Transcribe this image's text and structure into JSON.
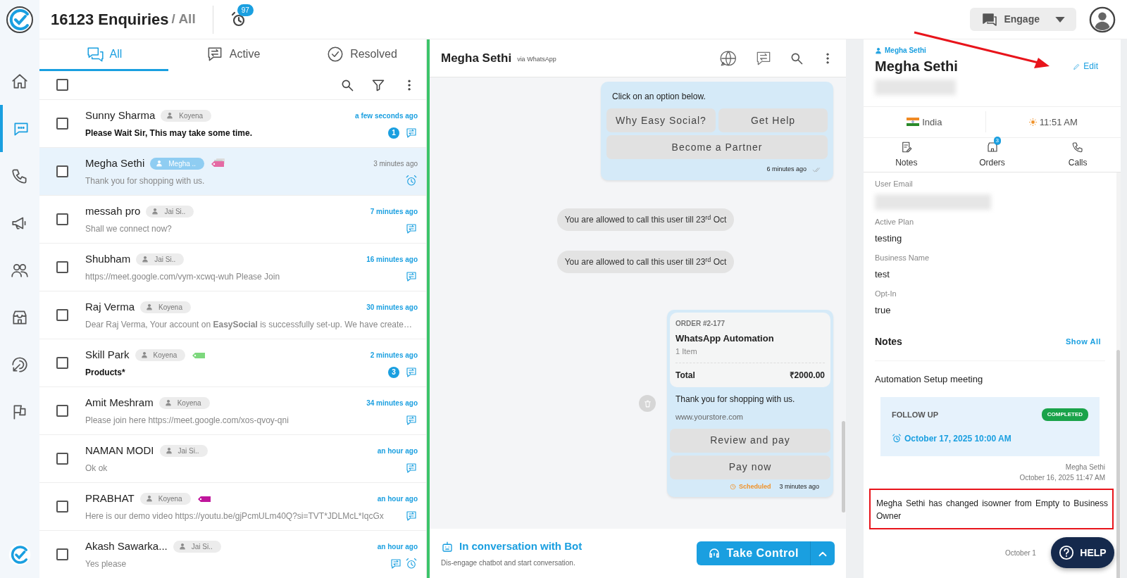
{
  "header": {
    "title": "16123 Enquiries",
    "scope": "/ All",
    "reminder_count": "97",
    "engage": "Engage"
  },
  "rail": [
    {
      "kind": "home",
      "selected": false
    },
    {
      "kind": "chat",
      "selected": true
    },
    {
      "kind": "phone",
      "selected": false
    },
    {
      "kind": "megaphone",
      "selected": false
    },
    {
      "kind": "people",
      "selected": false
    },
    {
      "kind": "store",
      "selected": false
    },
    {
      "kind": "radar",
      "selected": false
    },
    {
      "kind": "flags",
      "selected": false
    }
  ],
  "tabs": [
    {
      "label": "All",
      "kind": "all",
      "selected": true
    },
    {
      "label": "Active",
      "kind": "active",
      "selected": false
    },
    {
      "label": "Resolved",
      "kind": "resolved",
      "selected": false
    }
  ],
  "list": {
    "select_all_checked": false,
    "rows": [
      {
        "name": "Sunny Sharma",
        "agent": "Koyena",
        "agent_mine": false,
        "time": "a few seconds ago",
        "preview": "Please Wait Sir, This may take some time.",
        "unread": true,
        "unread_count": "1",
        "chat_icon": true,
        "alarm_icon": false,
        "selected": false,
        "checked": false
      },
      {
        "name": "Megha Sethi",
        "agent": "Megha ..",
        "agent_mine": true,
        "tag": {
          "kind": "stack",
          "color": "#e46aa4"
        },
        "time": "3 minutes ago",
        "preview": "Thank you for shopping with us.",
        "unread": false,
        "chat_icon": false,
        "alarm_icon": true,
        "selected": true,
        "checked": false
      },
      {
        "name": "messah pro",
        "agent": "Jai Si..",
        "agent_mine": false,
        "time": "7 minutes ago",
        "preview": "Shall we connect now?",
        "unread": false,
        "chat_icon": true,
        "alarm_icon": false,
        "selected": false,
        "checked": false
      },
      {
        "name": "Shubham",
        "agent": "Jai Si..",
        "agent_mine": false,
        "time": "16 minutes ago",
        "preview": "https://meet.google.com/vym-xcwq-wuh Please Join",
        "unread": false,
        "chat_icon": true,
        "alarm_icon": false,
        "selected": false,
        "checked": false
      },
      {
        "name": "Raj Verma",
        "agent": "Koyena",
        "agent_mine": false,
        "time": "30 minutes ago",
        "preview": "Dear Raj Verma, Your account on **EasySocial** is successfully set-up. We have create…",
        "unread": false,
        "chat_icon": false,
        "alarm_icon": false,
        "selected": false,
        "checked": false
      },
      {
        "name": "Skill Park",
        "agent": "Koyena",
        "agent_mine": false,
        "tag": {
          "kind": "single",
          "color": "#7dd87d"
        },
        "time": "2 minutes ago",
        "preview": "Products*",
        "unread": true,
        "unread_count": "3",
        "chat_icon": true,
        "alarm_icon": false,
        "selected": false,
        "checked": false
      },
      {
        "name": "Amit Meshram",
        "agent": "Koyena",
        "agent_mine": false,
        "time": "34 minutes ago",
        "preview": "Please join here https://meet.google.com/xos-qvoy-qni",
        "unread": false,
        "chat_icon": true,
        "alarm_icon": false,
        "selected": false,
        "checked": false
      },
      {
        "name": "NAMAN MODI",
        "agent": "Jai Si..",
        "agent_mine": false,
        "time": "an hour ago",
        "preview": "Ok ok",
        "unread": false,
        "chat_icon": true,
        "alarm_icon": false,
        "selected": false,
        "checked": false
      },
      {
        "name": "PRABHAT",
        "agent": "Koyena",
        "agent_mine": false,
        "tag": {
          "kind": "single",
          "color": "#c0169c"
        },
        "time": "an hour ago",
        "preview": "Here is our demo video https://youtu.be/gjPcmULm40Q?si=TVT*JDLMcL*IqcGx",
        "unread": false,
        "chat_icon": true,
        "alarm_icon": false,
        "selected": false,
        "checked": false
      },
      {
        "name": "Akash Sawarka...",
        "agent": "Jai Si..",
        "agent_mine": false,
        "time": "an hour ago",
        "preview": "Yes please",
        "unread": false,
        "chat_icon": true,
        "alarm_icon": true,
        "selected": false,
        "checked": false
      }
    ]
  },
  "chat": {
    "name": "Megha Sethi",
    "channel": "via WhatsApp",
    "messages": [
      {
        "kind": "options",
        "text": "Click on an option below.",
        "buttons": [
          "Why Easy Social?",
          "Get Help",
          "Become a Partner"
        ],
        "time": "6 minutes ago"
      },
      {
        "kind": "notice",
        "text": "You are allowed to call this user till 23$^{rd}$ Oct"
      },
      {
        "kind": "notice",
        "text": "You are allowed to call this user till 23$^{rd}$ Oct"
      },
      {
        "kind": "order",
        "order_no": "ORDER #2-177",
        "product": "WhatsApp Automation",
        "items": "1 Item",
        "total_label": "Total",
        "total": "₹2000.00",
        "text": "Thank you for shopping with us.",
        "link": "www.yourstore.com",
        "buttons": [
          "Review and pay",
          "Pay now"
        ],
        "status": "Scheduled",
        "time": "3 minutes ago"
      }
    ],
    "footer": {
      "title": "In conversation with Bot",
      "subtitle": "Dis-engage chatbot and start conversation.",
      "button": "Take Control"
    }
  },
  "contact": {
    "owner": "Megha Sethi",
    "name": "Megha Sethi",
    "edit": {
      "label": "Edit",
      "pointed": true
    },
    "country": "India",
    "local_time": "11:51 AM",
    "tabs": [
      {
        "label": "Notes",
        "kind": "notes"
      },
      {
        "label": "Orders",
        "kind": "orders",
        "badge": "3"
      },
      {
        "label": "Calls",
        "kind": "calls"
      }
    ],
    "fields": [
      {
        "label": "User Email"
      },
      {
        "label": "Active Plan",
        "value": "testing"
      },
      {
        "label": "Business Name",
        "value": "test"
      },
      {
        "label": "Opt-In",
        "value": "true"
      }
    ],
    "notes": {
      "title": "Notes",
      "show_all": "Show All",
      "note": {
        "text": "Automation Setup meeting",
        "follow_up": {
          "label": "FOLLOW UP",
          "status": "COMPLETED",
          "date": "October 17, 2025 10:00 AM"
        },
        "author": "Megha Sethi",
        "date": "October 16, 2025 11:47 AM"
      },
      "activity": {
        "text": "Megha Sethi has changed isowner from Empty to Business Owner",
        "highlighted": true,
        "date": "October 1"
      }
    }
  },
  "help": "HELP"
}
